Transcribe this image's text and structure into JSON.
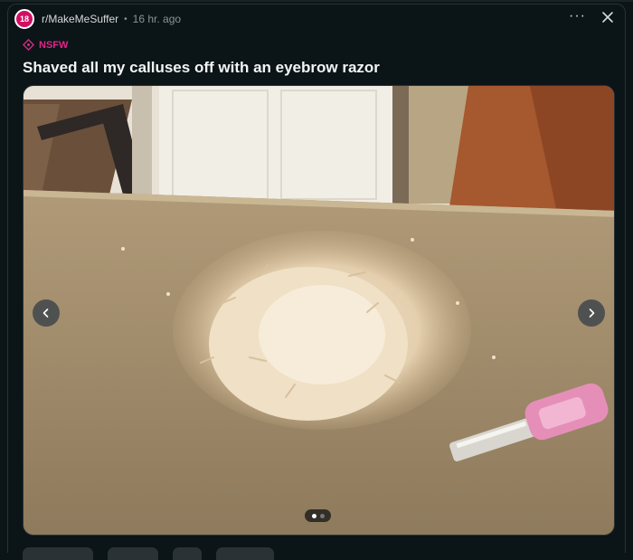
{
  "post": {
    "avatar_text": "18",
    "subreddit": "r/MakeMeSuffer",
    "separator": "•",
    "time": "16 hr. ago",
    "tag": "NSFW",
    "title": "Shaved all my calluses off with an eyebrow razor"
  },
  "header": {
    "more_label": "···"
  },
  "gallery": {
    "current_page": 1,
    "total_pages": 2
  },
  "colors": {
    "brand_avatar": "#d20e64",
    "nsfw": "#e0268a",
    "background": "#0b1416"
  },
  "icons": {
    "close": "close-icon",
    "prev": "chevron-left-icon",
    "next": "chevron-right-icon",
    "nsfw": "nsfw-icon"
  }
}
